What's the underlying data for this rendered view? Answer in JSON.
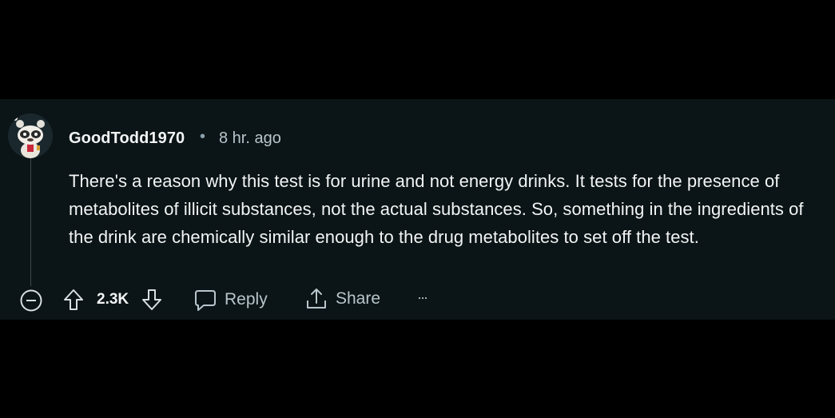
{
  "comment": {
    "username": "GoodTodd1970",
    "separator": "•",
    "timestamp": "8 hr. ago",
    "body": "There's a reason why this test is for urine and not energy drinks. It tests for the presence of metabolites of illicit substances, not the actual substances. So, something in the ingredients of the drink are chemically similar enough to the drug metabolites to set off the test.",
    "score": "2.3K",
    "reply_label": "Reply",
    "share_label": "Share",
    "more_label": "···",
    "avatar_icon": "snoo-avatar-icon"
  },
  "colors": {
    "background": "#000000",
    "comment_background": "#0b1416",
    "text_primary": "#f2f4f5",
    "text_secondary": "#b7c6cc"
  }
}
